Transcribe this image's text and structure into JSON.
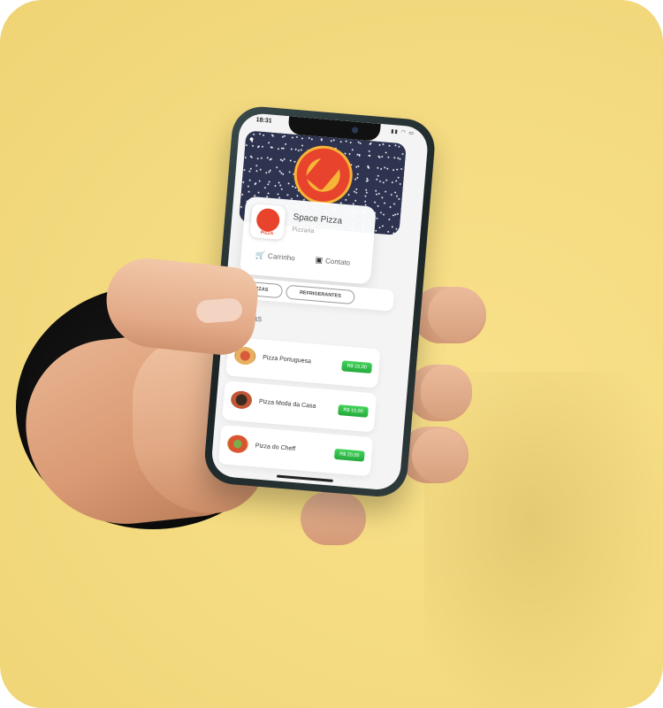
{
  "status_bar": {
    "time": "18:31",
    "icons": "▮▮ ◠ ▭"
  },
  "banner": {
    "user_icon": "user-icon"
  },
  "restaurant": {
    "name": "Space Pizza",
    "category": "Pizzaria",
    "logo_text": "PIZZA"
  },
  "actions": {
    "cart_icon": "🛒",
    "cart_label": "Carrinho",
    "contact_icon": "▣",
    "contact_label": "Contato"
  },
  "tabs": [
    "PIZZAS",
    "REFRIGERANTES"
  ],
  "section": {
    "title": "Pizzas"
  },
  "items": [
    {
      "name": "Pizza Portuguesa",
      "price": "R$ 15,00"
    },
    {
      "name": "Pizza Moda da Casa",
      "price": "R$ 15,00"
    },
    {
      "name": "Pizza do Cheff",
      "price": "R$ 20,00"
    }
  ],
  "colors": {
    "background": "#f5dc82",
    "brand_red": "#e8432d",
    "brand_yellow": "#f6b536",
    "banner_space": "#2e3350",
    "price_green": "#2fbf4a"
  }
}
